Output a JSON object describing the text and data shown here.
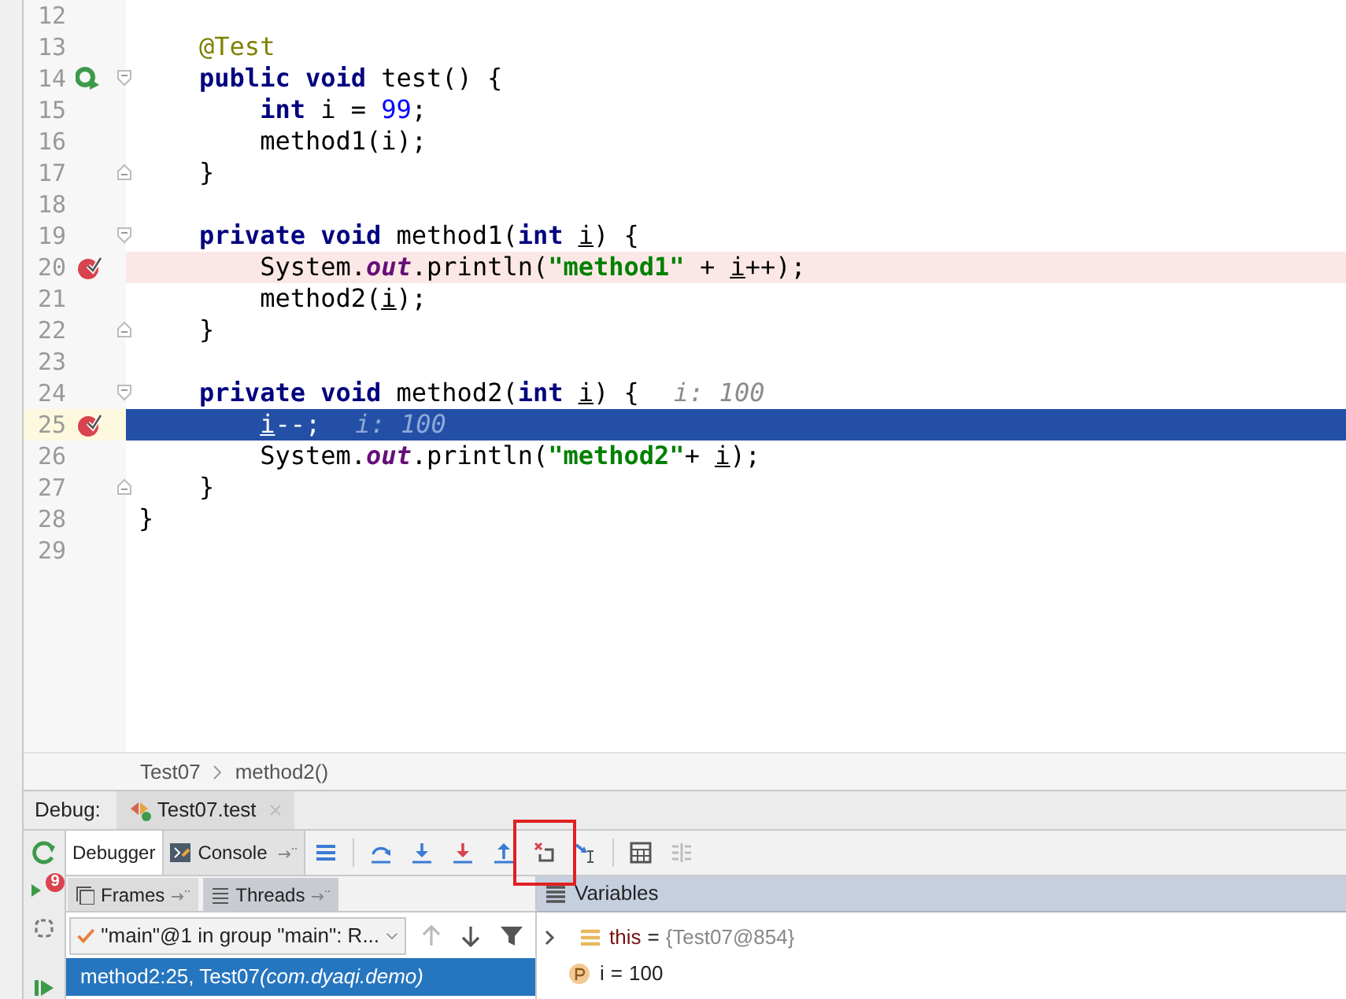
{
  "editor": {
    "lines": [
      {
        "number": "12"
      },
      {
        "number": "13",
        "tokens": [
          {
            "kind": "annotation",
            "text": "    @Test"
          }
        ]
      },
      {
        "number": "14",
        "gutter": {
          "kind": "run"
        },
        "fold": {
          "kind": "start"
        },
        "tokens": [
          {
            "kind": "keyword",
            "text": "    public void "
          },
          {
            "kind": "plain",
            "text": "test() {"
          }
        ]
      },
      {
        "number": "15",
        "tokens": [
          {
            "kind": "keyword",
            "text": "        int "
          },
          {
            "kind": "plain",
            "text": "i = "
          },
          {
            "kind": "number",
            "text": "99"
          },
          {
            "kind": "plain",
            "text": ";"
          }
        ]
      },
      {
        "number": "16",
        "tokens": [
          {
            "kind": "plain",
            "text": "        method1(i);"
          }
        ]
      },
      {
        "number": "17",
        "fold": {
          "kind": "end"
        },
        "tokens": [
          {
            "kind": "plain",
            "text": "    }"
          }
        ]
      },
      {
        "number": "18"
      },
      {
        "number": "19",
        "fold": {
          "kind": "start"
        },
        "tokens": [
          {
            "kind": "keyword",
            "text": "    private void "
          },
          {
            "kind": "plain",
            "text": "method1("
          },
          {
            "kind": "keyword",
            "text": "int "
          },
          {
            "kind": "param",
            "text": "i"
          },
          {
            "kind": "plain",
            "text": ") {"
          }
        ]
      },
      {
        "number": "20",
        "gutter": {
          "kind": "breakpoint"
        },
        "highlight": {
          "kind": "breakpoint"
        },
        "tokens": [
          {
            "kind": "plain",
            "text": "        System."
          },
          {
            "kind": "static",
            "text": "out"
          },
          {
            "kind": "plain",
            "text": ".println("
          },
          {
            "kind": "string",
            "text": "\"method1\""
          },
          {
            "kind": "plain",
            "text": " + "
          },
          {
            "kind": "param",
            "text": "i"
          },
          {
            "kind": "plain",
            "text": "++);"
          }
        ]
      },
      {
        "number": "21",
        "tokens": [
          {
            "kind": "plain",
            "text": "        method2("
          },
          {
            "kind": "param",
            "text": "i"
          },
          {
            "kind": "plain",
            "text": ");"
          }
        ]
      },
      {
        "number": "22",
        "fold": {
          "kind": "end"
        },
        "tokens": [
          {
            "kind": "plain",
            "text": "    }"
          }
        ]
      },
      {
        "number": "23"
      },
      {
        "number": "24",
        "fold": {
          "kind": "start"
        },
        "tokens": [
          {
            "kind": "keyword",
            "text": "    private void "
          },
          {
            "kind": "plain",
            "text": "method2("
          },
          {
            "kind": "keyword",
            "text": "int "
          },
          {
            "kind": "param",
            "text": "i"
          },
          {
            "kind": "plain",
            "text": ") {"
          }
        ],
        "hint": "i: 100"
      },
      {
        "number": "25",
        "gutter": {
          "kind": "breakpoint"
        },
        "highlight": {
          "kind": "execution"
        },
        "tokens": [
          {
            "kind": "param",
            "text": "        i"
          },
          {
            "kind": "plain",
            "text": "--;"
          }
        ],
        "hint": "i: 100"
      },
      {
        "number": "26",
        "tokens": [
          {
            "kind": "plain",
            "text": "        System."
          },
          {
            "kind": "static",
            "text": "out"
          },
          {
            "kind": "plain",
            "text": ".println("
          },
          {
            "kind": "string",
            "text": "\"method2\""
          },
          {
            "kind": "plain",
            "text": "+ "
          },
          {
            "kind": "param",
            "text": "i"
          },
          {
            "kind": "plain",
            "text": ");"
          }
        ]
      },
      {
        "number": "27",
        "fold": {
          "kind": "end"
        },
        "tokens": [
          {
            "kind": "plain",
            "text": "    }"
          }
        ]
      },
      {
        "number": "28",
        "tokens": [
          {
            "kind": "plain",
            "text": "}"
          }
        ]
      },
      {
        "number": "29"
      }
    ]
  },
  "breadcrumbs": [
    "Test07",
    "method2()"
  ],
  "debug": {
    "label": "Debug:",
    "session_tab": "Test07.test",
    "side_toolbar": [
      {
        "kind": "rerun"
      },
      {
        "kind": "breakpoints",
        "badge": "9"
      },
      {
        "kind": "restore"
      },
      {
        "kind": "resume"
      }
    ],
    "tabs": [
      {
        "label": "Debugger",
        "selected": true
      },
      {
        "label": "Console",
        "selected": false
      }
    ],
    "toolbar": [
      {
        "kind": "layout",
        "highlighted": false
      },
      {
        "kind": "step-over",
        "highlighted": false
      },
      {
        "kind": "step-into",
        "highlighted": false
      },
      {
        "kind": "force-step-into",
        "highlighted": false
      },
      {
        "kind": "step-out",
        "highlighted": false
      },
      {
        "kind": "drop-frame",
        "highlighted": true
      },
      {
        "kind": "run-to-cursor",
        "highlighted": false
      },
      {
        "kind": "evaluate",
        "highlighted": false
      },
      {
        "kind": "trace",
        "highlighted": false
      }
    ],
    "frames_tabs": [
      {
        "label": "Frames",
        "selected": true
      },
      {
        "label": "Threads",
        "selected": false
      }
    ],
    "thread_select": "\"main\"@1 in group \"main\": R...",
    "frames": [
      {
        "method": "method2:25, Test07",
        "package": "(com.dyaqi.demo)",
        "selected": true
      }
    ],
    "variables": {
      "title": "Variables",
      "items": [
        {
          "kind": "object",
          "name": "this",
          "operator": "=",
          "value": "{Test07@854}"
        },
        {
          "kind": "param",
          "name": "i",
          "operator": "=",
          "value": "100"
        }
      ]
    }
  }
}
